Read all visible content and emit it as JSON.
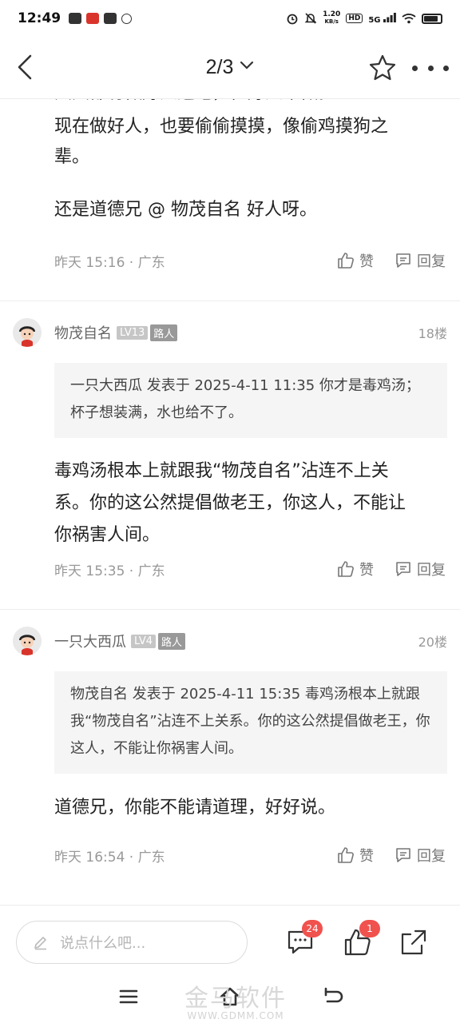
{
  "status_bar": {
    "time": "12:49",
    "net_speed_value": "1.20",
    "net_speed_unit": "KB/s",
    "hd": "HD",
    "signal": "5G"
  },
  "nav": {
    "page_indicator": "2/3"
  },
  "top_fragment": {
    "paragraphs": [
      "现在做好人，也要偷偷摸摸，像偷鸡摸狗之辈。",
      "还是道德兄 @ 物茂自名 好人呀。"
    ],
    "meta": "昨天 15:16 · 广东",
    "like_label": "赞",
    "reply_label": "回复"
  },
  "comments": [
    {
      "author": "物茂自名",
      "level": "LV13",
      "role": "路人",
      "floor": "18楼",
      "quote": "一只大西瓜 发表于 2025-4-11 11:35 你才是毒鸡汤； 杯子想装满，水也给不了。",
      "text": "毒鸡汤根本上就跟我“物茂自名”沾连不上关系。你的这公然提倡做老王，你这人，不能让你祸害人间。",
      "meta": "昨天 15:35 · 广东",
      "like_label": "赞",
      "reply_label": "回复"
    },
    {
      "author": "一只大西瓜",
      "level": "LV4",
      "role": "路人",
      "floor": "20楼",
      "quote": "物茂自名 发表于 2025-4-11 15:35 毒鸡汤根本上就跟我“物茂自名”沾连不上关系。你的这公然提倡做老王，你这人，不能让你祸害人间。",
      "text": "道德兄，你能不能请道理，好好说。",
      "meta": "昨天 16:54 · 广东",
      "like_label": "赞",
      "reply_label": "回复"
    }
  ],
  "bottom_bar": {
    "input_placeholder": "说点什么吧...",
    "comment_count": "24",
    "like_count": "1"
  },
  "watermark": {
    "text": "金马软件",
    "url": "WWW.GDMM.COM"
  },
  "colors": {
    "badge_red": "#f0524e",
    "quote_bg": "#f5f5f5"
  }
}
